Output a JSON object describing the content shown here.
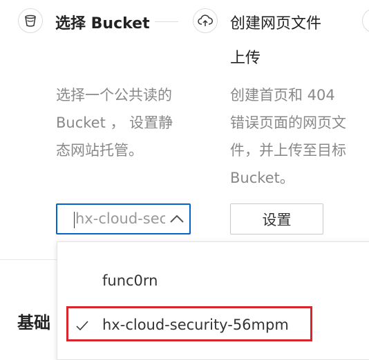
{
  "steps": [
    {
      "title": "选择 Bucket",
      "desc_lines": [
        "选择一个公共读的",
        "Bucket ， 设置静",
        "态网站托管。"
      ]
    },
    {
      "title_lines": [
        "创建网页文件",
        "上传"
      ],
      "desc_lines": [
        "创建首页和 404",
        "错误页面的网页文",
        "件，并上传至目标",
        "Bucket。"
      ]
    }
  ],
  "bucket_select": {
    "value": "hx-cloud-security-56mpm",
    "options": [
      {
        "label": "func0rn",
        "selected": false
      },
      {
        "label": "hx-cloud-security-56mpm",
        "selected": true
      }
    ]
  },
  "settings_button": {
    "label": "设置"
  },
  "section": {
    "title": "基础"
  },
  "colors": {
    "accent": "#0064c8",
    "highlight": "#d9262c"
  }
}
